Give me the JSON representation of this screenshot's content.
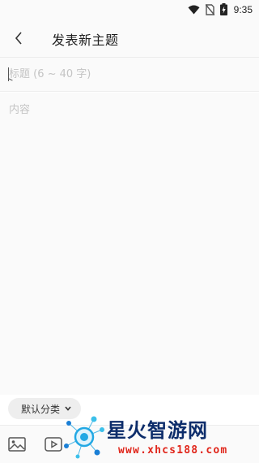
{
  "status_bar": {
    "time": "9:35",
    "icons": [
      "wifi-icon",
      "no-sim-icon",
      "battery-charging-icon"
    ]
  },
  "header": {
    "title": "发表新主题",
    "back_icon": "chevron-left-icon"
  },
  "title_field": {
    "placeholder": "标题 (6 ~ 40 字)",
    "value": ""
  },
  "content_field": {
    "placeholder": "内容",
    "value": ""
  },
  "category": {
    "label": "默认分类",
    "icon": "chevron-down-icon"
  },
  "toolbar": {
    "items": [
      "image-icon",
      "video-icon"
    ]
  },
  "watermark": {
    "brand": "星火智游网",
    "url": "www.xhcs188.com"
  },
  "colors": {
    "background": "#fafafa",
    "placeholder": "#c4c4c4",
    "watermark_brand": "#0d2d6b",
    "watermark_url": "#e0261b"
  }
}
